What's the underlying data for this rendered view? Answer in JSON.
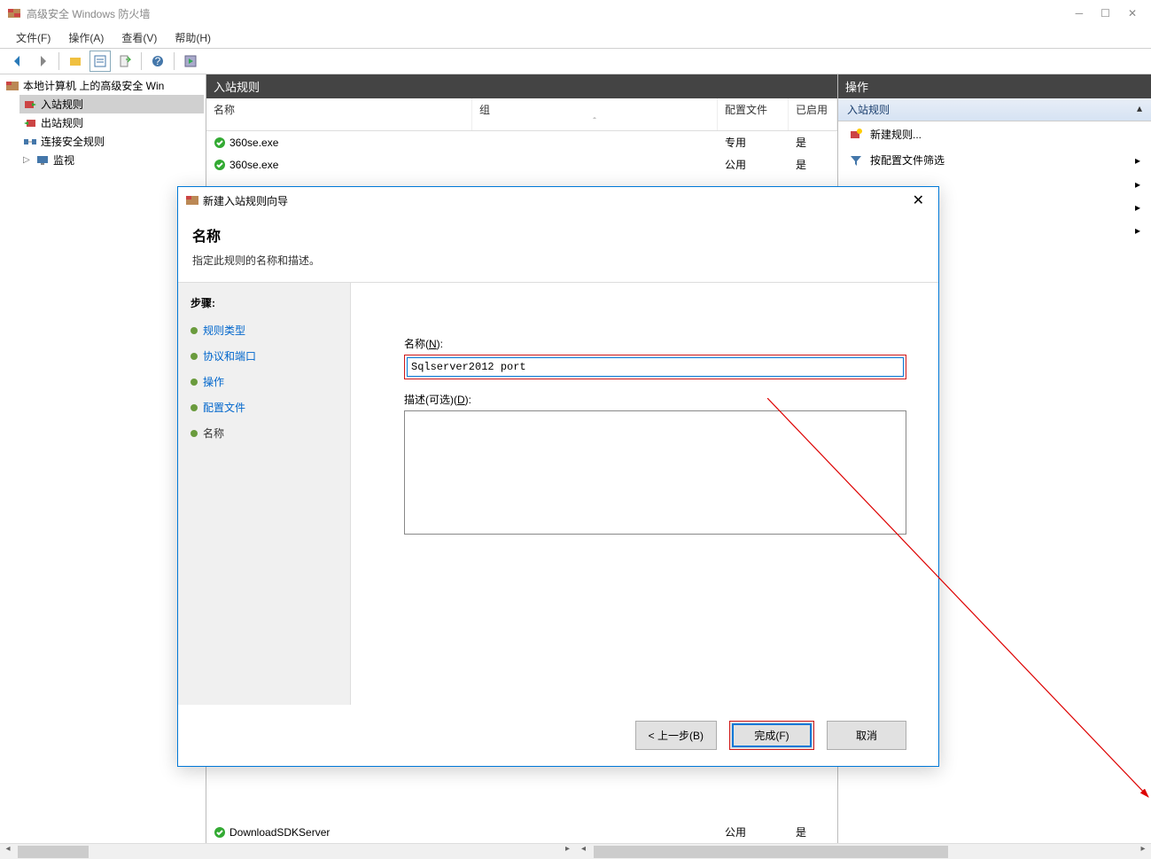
{
  "window": {
    "title": "高级安全 Windows 防火墙"
  },
  "menu": {
    "file": "文件(F)",
    "action": "操作(A)",
    "view": "查看(V)",
    "help": "帮助(H)"
  },
  "tree": {
    "root": "本地计算机 上的高级安全 Win",
    "items": [
      {
        "label": "入站规则"
      },
      {
        "label": "出站规则"
      },
      {
        "label": "连接安全规则"
      },
      {
        "label": "监视"
      }
    ]
  },
  "center": {
    "header": "入站规则",
    "columns": {
      "name": "名称",
      "group": "组",
      "profile": "配置文件",
      "enabled": "已启用"
    },
    "rows": [
      {
        "name": "360se.exe",
        "profile": "专用",
        "enabled": "是"
      },
      {
        "name": "360se.exe",
        "profile": "公用",
        "enabled": "是"
      }
    ],
    "bottomRows": [
      {
        "name": "DownloadSDKServer",
        "profile": "公用",
        "enabled": "是"
      }
    ]
  },
  "actions": {
    "header": "操作",
    "section": "入站规则",
    "items": [
      {
        "label": "新建规则..."
      },
      {
        "label": "按配置文件筛选"
      }
    ]
  },
  "dialog": {
    "title": "新建入站规则向导",
    "heading": "名称",
    "subheading": "指定此规则的名称和描述。",
    "stepsTitle": "步骤:",
    "steps": [
      "规则类型",
      "协议和端口",
      "操作",
      "配置文件",
      "名称"
    ],
    "nameLabel": "名称(",
    "nameMnemonic": "N",
    "nameLabelEnd": "):",
    "nameValue": "Sqlserver2012 port",
    "descLabel": "描述(可选)(",
    "descMnemonic": "D",
    "descLabelEnd": "):",
    "descValue": "",
    "buttons": {
      "back": "< 上一步(B)",
      "finish": "完成(F)",
      "cancel": "取消"
    }
  }
}
